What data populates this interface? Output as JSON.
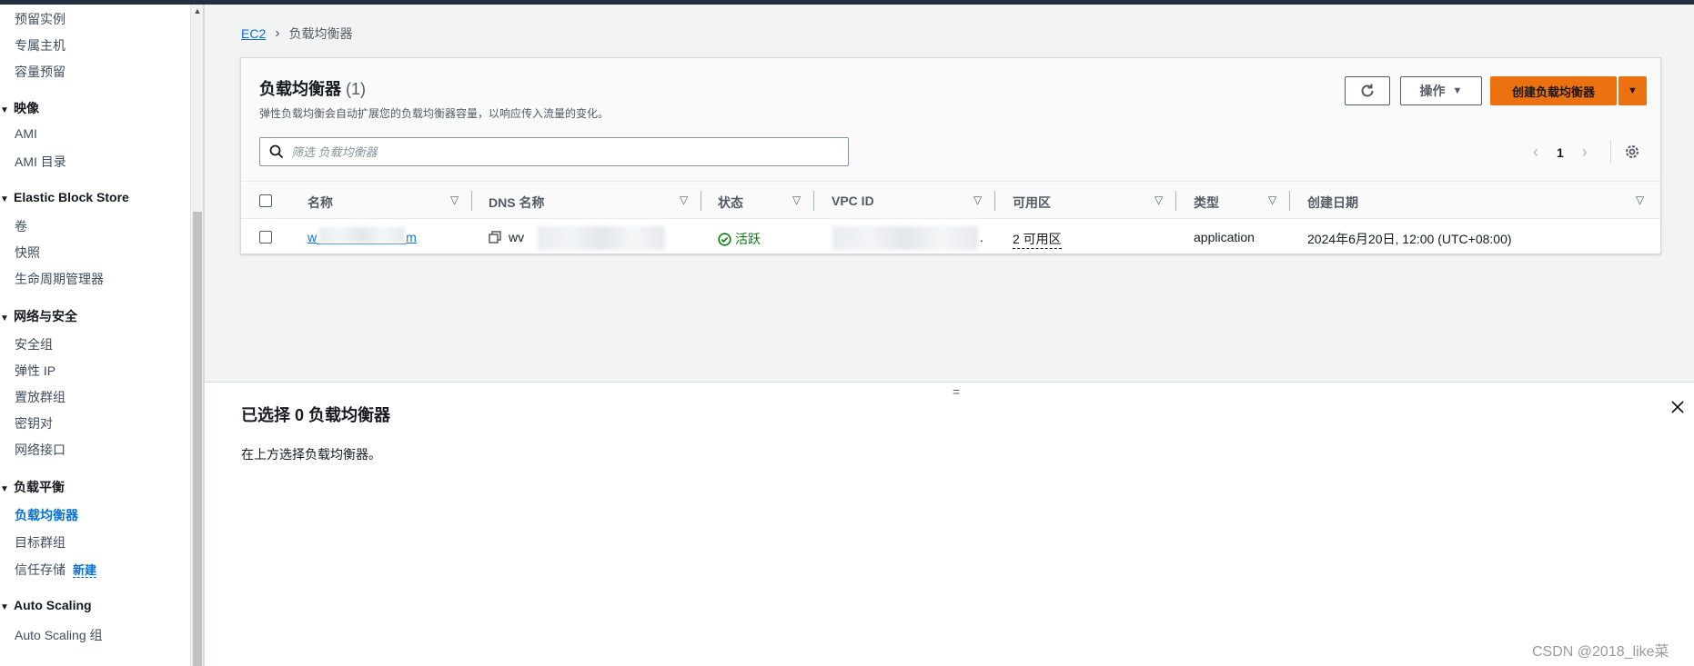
{
  "sidebar": {
    "items_top": [
      {
        "label": "预留实例"
      },
      {
        "label": "专属主机"
      },
      {
        "label": "容量预留"
      }
    ],
    "sections": [
      {
        "title": "映像",
        "items": [
          "AMI",
          "AMI 目录"
        ]
      },
      {
        "title": "Elastic Block Store",
        "items": [
          "卷",
          "快照",
          "生命周期管理器"
        ]
      },
      {
        "title": "网络与安全",
        "items": [
          "安全组",
          "弹性 IP",
          "置放群组",
          "密钥对",
          "网络接口"
        ]
      },
      {
        "title": "负载平衡",
        "items": [
          "负载均衡器",
          "目标群组",
          "信任存储"
        ]
      },
      {
        "title": "Auto Scaling",
        "items": [
          "Auto Scaling 组"
        ]
      }
    ],
    "new_badge": "新建",
    "active_item": "负载均衡器"
  },
  "breadcrumb": {
    "root": "EC2",
    "current": "负载均衡器"
  },
  "panel": {
    "title": "负载均衡器",
    "count": "(1)",
    "description": "弹性负载均衡会自动扩展您的负载均衡器容量，以响应传入流量的变化。",
    "actions_label": "操作",
    "create_label": "创建负载均衡器",
    "search_placeholder": "筛选 负载均衡器",
    "page": "1"
  },
  "table": {
    "columns": [
      "名称",
      "DNS 名称",
      "状态",
      "VPC ID",
      "可用区",
      "类型",
      "创建日期"
    ],
    "rows": [
      {
        "name_start": "w",
        "name_end": "m",
        "dns_start": "wv",
        "status": "活跃",
        "vpc_end": ".",
        "az": "2 可用区",
        "type": "application",
        "created": "2024年6月20日, 12:00 (UTC+08:00)"
      }
    ]
  },
  "split_panel": {
    "title": "已选择 0 负载均衡器",
    "description": "在上方选择负载均衡器。",
    "handle": "="
  },
  "watermark": "CSDN @2018_like菜",
  "colors": {
    "accent": "#0972d3",
    "primary": "#ec7211",
    "success": "#037f0c"
  }
}
